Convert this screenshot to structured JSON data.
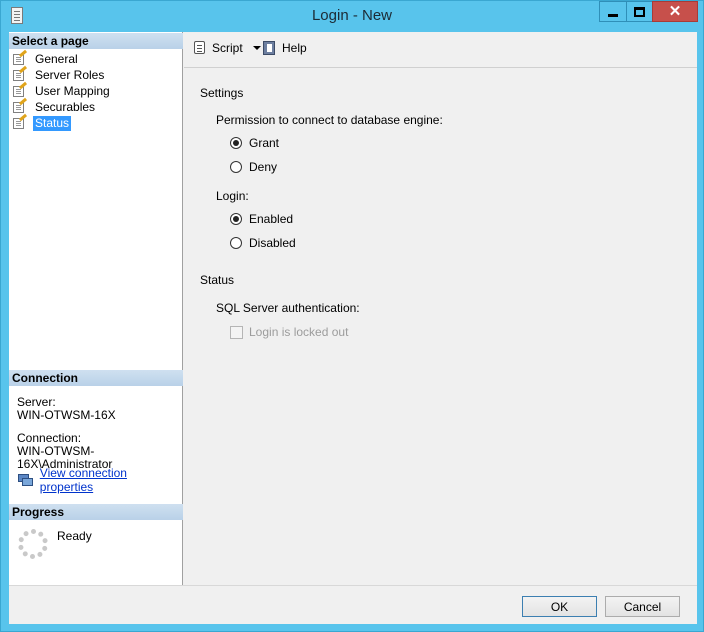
{
  "window": {
    "title": "Login - New",
    "close_glyph": "✕"
  },
  "sidebar": {
    "header": "Select a page",
    "pages": [
      {
        "label": "General",
        "icon": "wrench-page-icon"
      },
      {
        "label": "Server Roles",
        "icon": "wrench-page-icon"
      },
      {
        "label": "User Mapping",
        "icon": "wrench-page-icon"
      },
      {
        "label": "Securables",
        "icon": "wrench-page-icon"
      },
      {
        "label": "Status",
        "icon": "wrench-page-icon",
        "selected": true
      }
    ],
    "connection": {
      "header": "Connection",
      "server_label": "Server:",
      "server_value": "WIN-OTWSM-16X",
      "connection_label": "Connection:",
      "connection_value": "WIN-OTWSM-16X\\Administrator",
      "link_text": "View connection properties"
    },
    "progress": {
      "header": "Progress",
      "status": "Ready"
    }
  },
  "toolbar": {
    "script_label": "Script",
    "help_label": "Help"
  },
  "settings": {
    "title": "Settings",
    "permission_label": "Permission to connect to database engine:",
    "permission_options": [
      {
        "label": "Grant",
        "checked": true
      },
      {
        "label": "Deny",
        "checked": false
      }
    ],
    "login_label": "Login:",
    "login_options": [
      {
        "label": "Enabled",
        "checked": true
      },
      {
        "label": "Disabled",
        "checked": false
      }
    ]
  },
  "status": {
    "title": "Status",
    "auth_label": "SQL Server authentication:",
    "locked_label": "Login is locked out",
    "locked_checked": false,
    "locked_enabled": false
  },
  "buttons": {
    "ok": "OK",
    "cancel": "Cancel"
  },
  "colors": {
    "frame": "#58c4ec",
    "close_button": "#c7504b",
    "selection": "#3399ff",
    "link": "#0033cc"
  }
}
